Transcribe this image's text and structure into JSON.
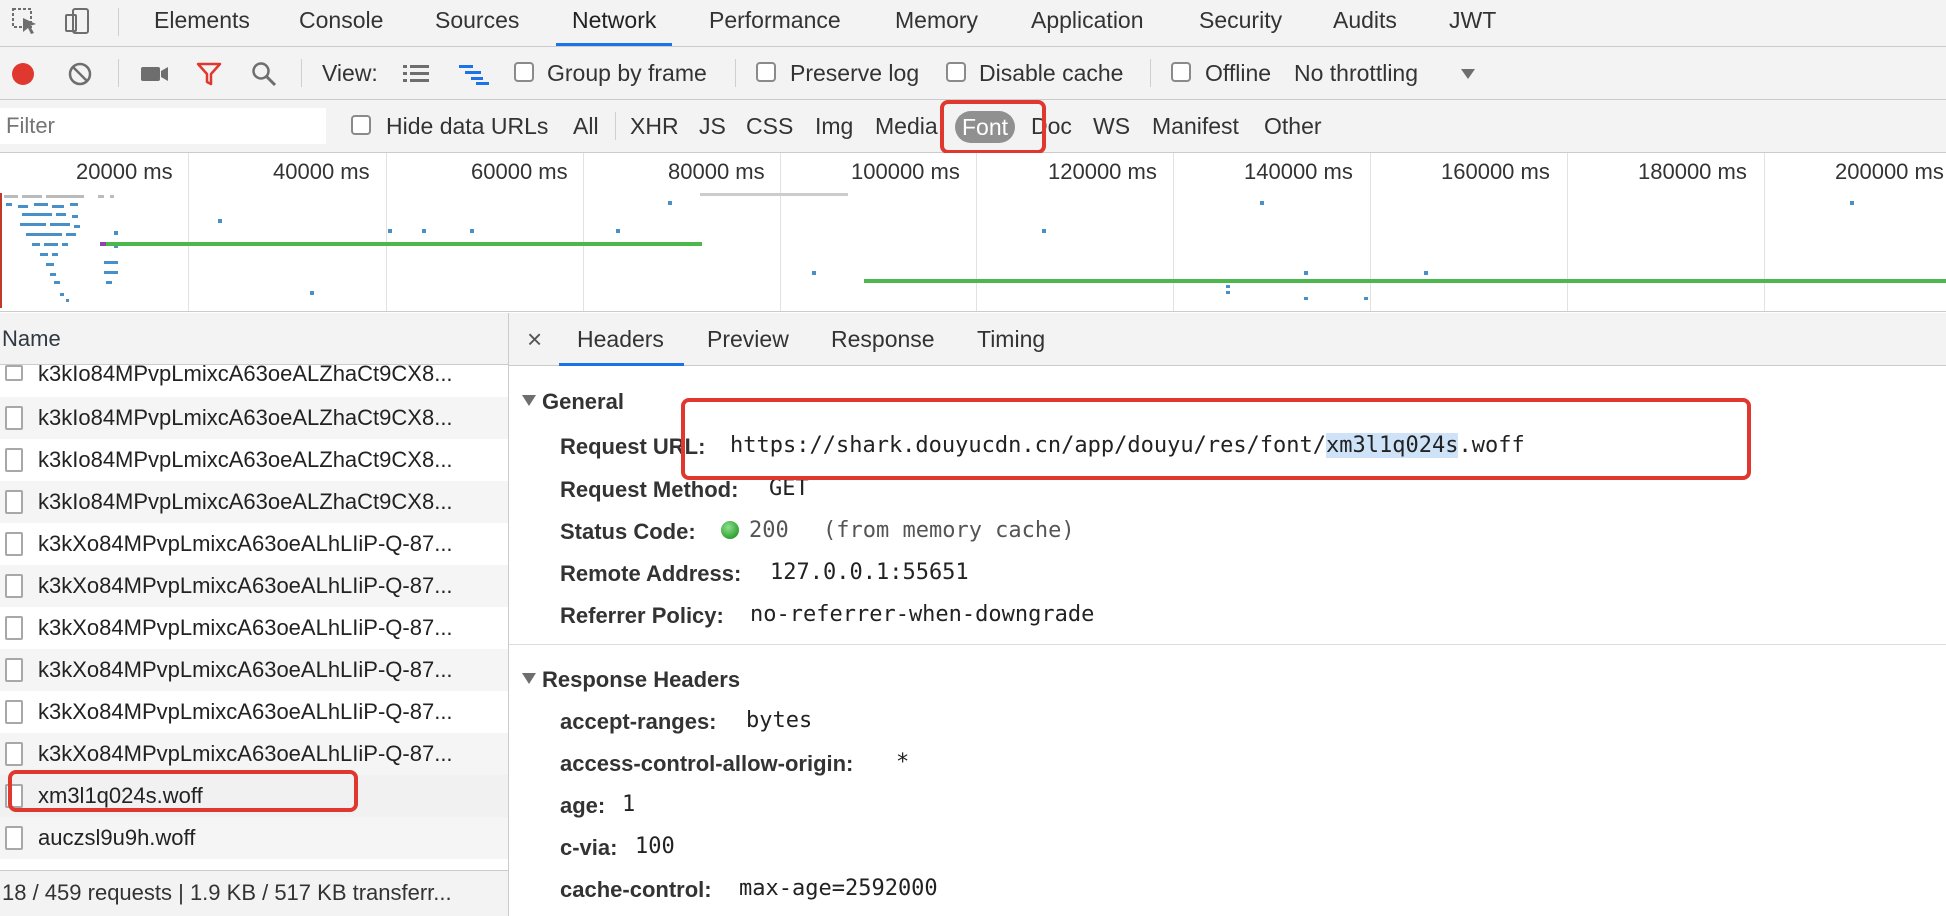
{
  "tabs": [
    "Elements",
    "Console",
    "Sources",
    "Network",
    "Performance",
    "Memory",
    "Application",
    "Security",
    "Audits",
    "JWT"
  ],
  "active_tab": "Network",
  "toolbar": {
    "view_label": "View:",
    "group_by_frame": "Group by frame",
    "preserve_log": "Preserve log",
    "disable_cache": "Disable cache",
    "offline": "Offline",
    "throttling": "No throttling"
  },
  "filterbar": {
    "placeholder": "Filter",
    "hide_data_urls": "Hide data URLs",
    "types": [
      "All",
      "XHR",
      "JS",
      "CSS",
      "Img",
      "Media",
      "Font",
      "Doc",
      "WS",
      "Manifest",
      "Other"
    ],
    "active_type": "Font"
  },
  "timeline": {
    "ticks": [
      "20000 ms",
      "40000 ms",
      "60000 ms",
      "80000 ms",
      "100000 ms",
      "120000 ms",
      "140000 ms",
      "160000 ms",
      "180000 ms",
      "200000 ms"
    ]
  },
  "list": {
    "header": "Name",
    "rows": [
      "k3kIo84MPvpLmixcA63oeALZhaCt9CX8...",
      "k3kIo84MPvpLmixcA63oeALZhaCt9CX8...",
      "k3kIo84MPvpLmixcA63oeALZhaCt9CX8...",
      "k3kIo84MPvpLmixcA63oeALZhaCt9CX8...",
      "k3kXo84MPvpLmixcA63oeALhLIiP-Q-87...",
      "k3kXo84MPvpLmixcA63oeALhLIiP-Q-87...",
      "k3kXo84MPvpLmixcA63oeALhLIiP-Q-87...",
      "k3kXo84MPvpLmixcA63oeALhLIiP-Q-87...",
      "k3kXo84MPvpLmixcA63oeALhLIiP-Q-87...",
      "k3kXo84MPvpLmixcA63oeALhLIiP-Q-87...",
      "xm3l1q024s.woff",
      "auczsl9u9h.woff"
    ],
    "summary": "18 / 459 requests | 1.9 KB / 517 KB transferr..."
  },
  "detail": {
    "close": "×",
    "tabs": [
      "Headers",
      "Preview",
      "Response",
      "Timing"
    ],
    "active_tab": "Headers",
    "general": {
      "title": "General",
      "request_url_key": "Request URL:",
      "request_url_prefix": "https://shark.douyucdn.cn/app/douyu/res/font/",
      "request_url_highlight": "xm3l1q024s",
      "request_url_suffix": ".woff",
      "request_method_key": "Request Method:",
      "request_method": "GET",
      "status_code_key": "Status Code:",
      "status_code": "200",
      "status_note": "(from memory cache)",
      "remote_address_key": "Remote Address:",
      "remote_address": "127.0.0.1:55651",
      "referrer_policy_key": "Referrer Policy:",
      "referrer_policy": "no-referrer-when-downgrade"
    },
    "response_headers": {
      "title": "Response Headers",
      "items": [
        {
          "key": "accept-ranges:",
          "value": "bytes"
        },
        {
          "key": "access-control-allow-origin:",
          "value": "*"
        },
        {
          "key": "age:",
          "value": "1"
        },
        {
          "key": "c-via:",
          "value": "100"
        },
        {
          "key": "cache-control:",
          "value": "max-age=2592000"
        }
      ]
    }
  },
  "colors": {
    "accent": "#1a73e8",
    "record": "#e0382e",
    "highlight_box": "#e0382e",
    "status_ok": "#33b233",
    "timeline_bar": "#4cb84c",
    "timeline_dot": "#4a90c8"
  }
}
